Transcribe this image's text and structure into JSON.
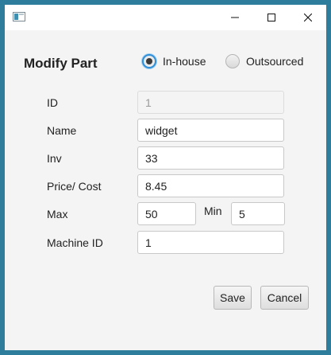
{
  "window": {
    "icon": "app-window-icon",
    "controls": {
      "minimize": "minimize-icon",
      "maximize": "maximize-icon",
      "close": "close-icon"
    }
  },
  "header": {
    "title": "Modify Part",
    "source_options": [
      {
        "label": "In-house",
        "selected": true
      },
      {
        "label": "Outsourced",
        "selected": false
      }
    ]
  },
  "form": {
    "id": {
      "label": "ID",
      "value": "1",
      "disabled": true
    },
    "name": {
      "label": "Name",
      "value": "widget"
    },
    "inv": {
      "label": "Inv",
      "value": "33"
    },
    "price": {
      "label": "Price/ Cost",
      "value": "8.45"
    },
    "max": {
      "label": "Max",
      "value": "50"
    },
    "min": {
      "label": "Min",
      "value": "5"
    },
    "machine_id": {
      "label": "Machine ID",
      "value": "1"
    }
  },
  "actions": {
    "save": "Save",
    "cancel": "Cancel"
  },
  "colors": {
    "background": "#2e7d9c",
    "accent": "#2f8fd8",
    "dialog": "#f4f4f4"
  }
}
